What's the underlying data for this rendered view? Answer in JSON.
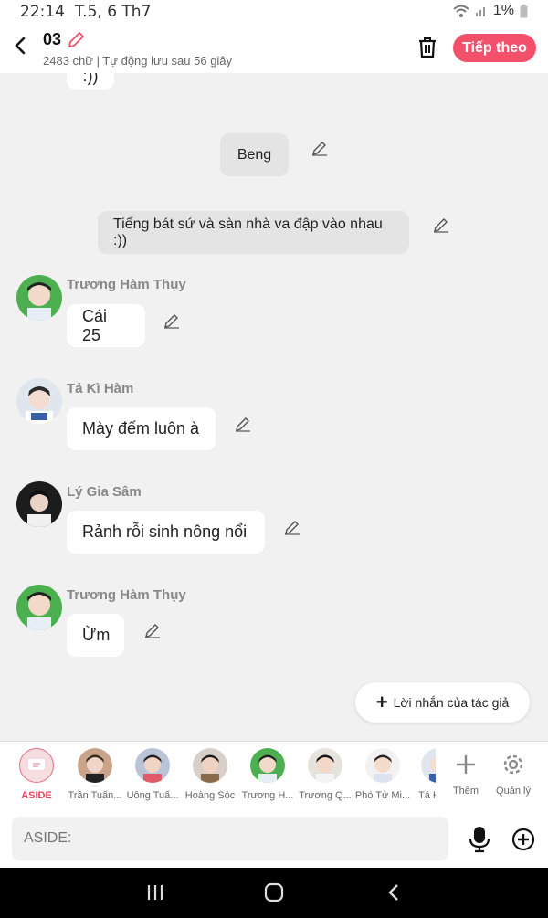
{
  "status": {
    "time": "22:14",
    "date": "T.5, 6 Th7",
    "battery": "1%"
  },
  "header": {
    "title": "03",
    "subtitle": "2483 chữ | Tự động lưu sau 56 giây",
    "next_label": "Tiếp theo"
  },
  "chat": {
    "partial_text": ":))",
    "narration_1": "Beng",
    "narration_2": "Tiếng bát sứ và sàn nhà va đập vào nhau :))",
    "messages": [
      {
        "name": "Trương Hàm Thụy",
        "text": "Cái 25"
      },
      {
        "name": "Tả Kì Hàm",
        "text": "Mày đếm luôn à"
      },
      {
        "name": "Lý Gia Sâm",
        "text": "Rảnh rỗi sinh nông nổi"
      },
      {
        "name": "Trương Hàm Thụy",
        "text": "Ừm"
      }
    ],
    "author_note": "Lời nhắn của tác giả"
  },
  "characters": [
    {
      "label": "ASIDE"
    },
    {
      "label": "Trần Tuấn..."
    },
    {
      "label": "Uông Tuấ..."
    },
    {
      "label": "Hoàng Sóc"
    },
    {
      "label": "Trương H..."
    },
    {
      "label": "Trương Q..."
    },
    {
      "label": "Phó Tử Mi..."
    },
    {
      "label": "Tả K"
    }
  ],
  "tools": {
    "add_label": "Thêm",
    "manage_label": "Quản lý"
  },
  "input": {
    "placeholder": "ASIDE:"
  },
  "colors": {
    "accent": "#f2506b",
    "background": "#f1f1f1",
    "bubble": "#ffffff",
    "narration": "#e4e4e4"
  }
}
